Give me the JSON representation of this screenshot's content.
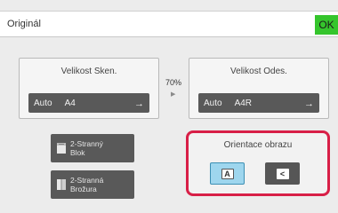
{
  "header": {
    "title": "Originál",
    "ok_label": "OK"
  },
  "scan_size": {
    "label": "Velikost Sken.",
    "mode": "Auto",
    "size": "A4"
  },
  "ratio": "70%",
  "send_size": {
    "label": "Velikost Odes.",
    "mode": "Auto",
    "size": "A4R"
  },
  "modes": [
    {
      "line1": "2-Stranný",
      "line2": "Blok",
      "icon": "tablet-pad-icon"
    },
    {
      "line1": "2-Stranná",
      "line2": "Brožura",
      "icon": "booklet-icon"
    }
  ],
  "orientation": {
    "label": "Orientace obrazu",
    "options": [
      {
        "glyph": "A",
        "state": "selected",
        "icon": "portrait-orientation-icon"
      },
      {
        "glyph": "<",
        "state": "unselected",
        "icon": "landscape-orientation-icon"
      }
    ]
  },
  "colors": {
    "ok": "#35c52c",
    "highlight_border": "#d81f47",
    "selected_fill": "#9ed6ee",
    "button_dark": "#595959"
  }
}
